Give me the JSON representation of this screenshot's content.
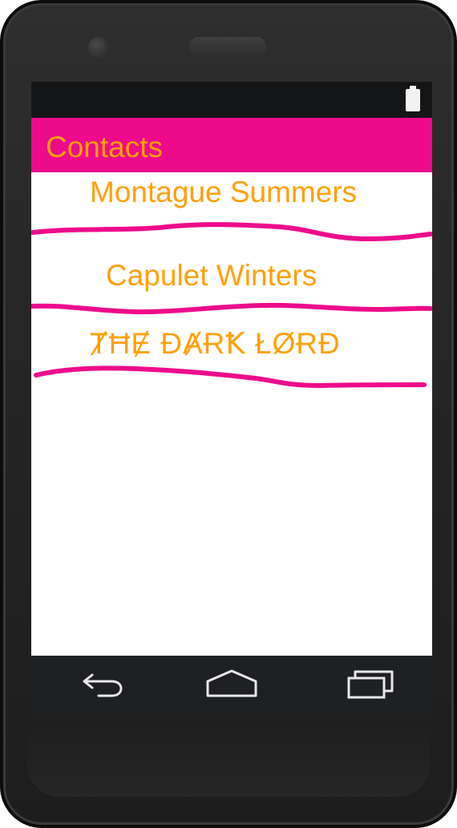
{
  "app": {
    "title": "Contacts"
  },
  "status_bar": {
    "battery_icon": "battery-full-icon"
  },
  "contacts": [
    {
      "name": "Montague Summers"
    },
    {
      "name": "Capulet Winters"
    },
    {
      "name": "ȾĦɆ ĐȺɌꝀ ŁØɌĐ"
    }
  ],
  "nav": {
    "back_icon": "back-arrow-icon",
    "home_icon": "home-icon",
    "recents_icon": "recents-icon"
  },
  "colors": {
    "accent": "#ed0b8c",
    "text": "#ffa00a",
    "status_bar": "#141517",
    "nav_bar": "#1e2023"
  }
}
